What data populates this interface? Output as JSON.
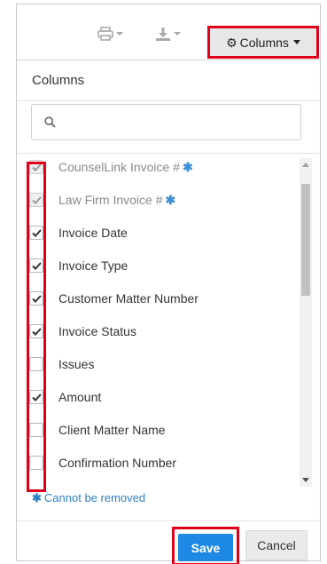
{
  "toolbar": {
    "print_icon": "printer-icon",
    "export_icon": "download-icon",
    "columns_label": "Columns",
    "columns_icon": "gear-icon"
  },
  "dropdown": {
    "title": "Columns",
    "search": {
      "placeholder": "",
      "value": "",
      "icon": "search-icon"
    },
    "items": [
      {
        "label": "CounselLink Invoice #",
        "checked": true,
        "required": true
      },
      {
        "label": "Law Firm Invoice #",
        "checked": true,
        "required": true
      },
      {
        "label": "Invoice Date",
        "checked": true,
        "required": false
      },
      {
        "label": "Invoice Type",
        "checked": true,
        "required": false
      },
      {
        "label": "Customer Matter Number",
        "checked": true,
        "required": false
      },
      {
        "label": "Invoice Status",
        "checked": true,
        "required": false
      },
      {
        "label": "Issues",
        "checked": false,
        "required": false
      },
      {
        "label": "Amount",
        "checked": true,
        "required": false
      },
      {
        "label": "Client Matter Name",
        "checked": false,
        "required": false
      },
      {
        "label": "Confirmation Number",
        "checked": false,
        "required": false
      }
    ],
    "legend": "Cannot be removed",
    "save_label": "Save",
    "cancel_label": "Cancel"
  },
  "colors": {
    "highlight": "#e0001a",
    "primary": "#1e88e5",
    "required_star": "#3c8fd6"
  }
}
